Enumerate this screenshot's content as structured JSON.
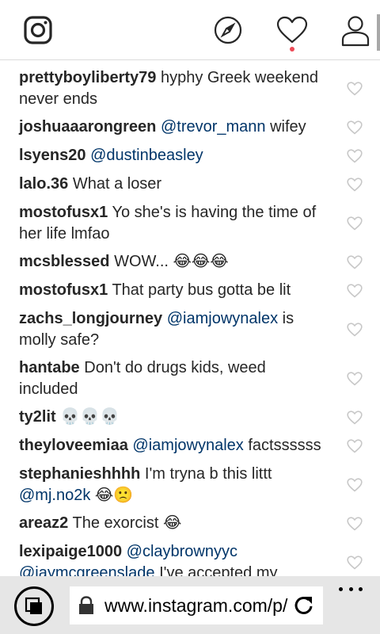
{
  "topbar": {
    "icons": [
      "instagram-logo",
      "explore-compass",
      "activity-heart",
      "profile-person"
    ],
    "notification_dot_color": "#ed4956"
  },
  "comments": [
    {
      "user": "prettyboyliberty79",
      "parts": [
        {
          "t": "text",
          "v": "hyphy Greek weekend never ends"
        }
      ]
    },
    {
      "user": "joshuaaarongreen",
      "parts": [
        {
          "t": "mention",
          "v": "@trevor_mann"
        },
        {
          "t": "text",
          "v": "wifey"
        }
      ]
    },
    {
      "user": "lsyens20",
      "parts": [
        {
          "t": "mention",
          "v": "@dustinbeasley"
        }
      ]
    },
    {
      "user": "lalo.36",
      "parts": [
        {
          "t": "text",
          "v": "What a loser"
        }
      ]
    },
    {
      "user": "mostofusx1",
      "parts": [
        {
          "t": "text",
          "v": "Yo she's is having the time of her life lmfao"
        }
      ]
    },
    {
      "user": "mcsblessed",
      "parts": [
        {
          "t": "text",
          "v": "WOW... 😂😂😂"
        }
      ]
    },
    {
      "user": "mostofusx1",
      "parts": [
        {
          "t": "text",
          "v": "That party bus gotta be lit"
        }
      ]
    },
    {
      "user": "zachs_longjourney",
      "parts": [
        {
          "t": "mention",
          "v": "@iamjowynalex"
        },
        {
          "t": "text",
          "v": "is molly safe?"
        }
      ]
    },
    {
      "user": "hantabe",
      "parts": [
        {
          "t": "text",
          "v": "Don't do drugs kids, weed included"
        }
      ]
    },
    {
      "user": "ty2lit",
      "parts": [
        {
          "t": "text",
          "v": "💀💀💀"
        }
      ]
    },
    {
      "user": "theyloveemiaa",
      "parts": [
        {
          "t": "mention",
          "v": "@iamjowynalex"
        },
        {
          "t": "text",
          "v": "factssssss"
        }
      ]
    },
    {
      "user": "stephanieshhhh",
      "parts": [
        {
          "t": "text",
          "v": "I'm tryna b this littt"
        },
        {
          "t": "mention",
          "v": "@mj.no2k"
        },
        {
          "t": "text",
          "v": "😂🙁"
        }
      ]
    },
    {
      "user": "areaz2",
      "parts": [
        {
          "t": "text",
          "v": "The exorcist 😂"
        }
      ]
    },
    {
      "user": "lexipaige1000",
      "parts": [
        {
          "t": "mention",
          "v": "@claybrownyyc"
        },
        {
          "t": "mention",
          "v": "@jaymcgreenslade"
        },
        {
          "t": "text",
          "v": "I've accepted my"
        }
      ]
    }
  ],
  "browser": {
    "url": "www.instagram.com/p/",
    "icons": [
      "tabs-icon",
      "lock-icon",
      "reload-icon",
      "more-icon"
    ]
  },
  "colors": {
    "mention": "#003569",
    "text": "#262626",
    "icon_gray": "#c7c7c7",
    "bottombar": "#e6e6e6"
  }
}
